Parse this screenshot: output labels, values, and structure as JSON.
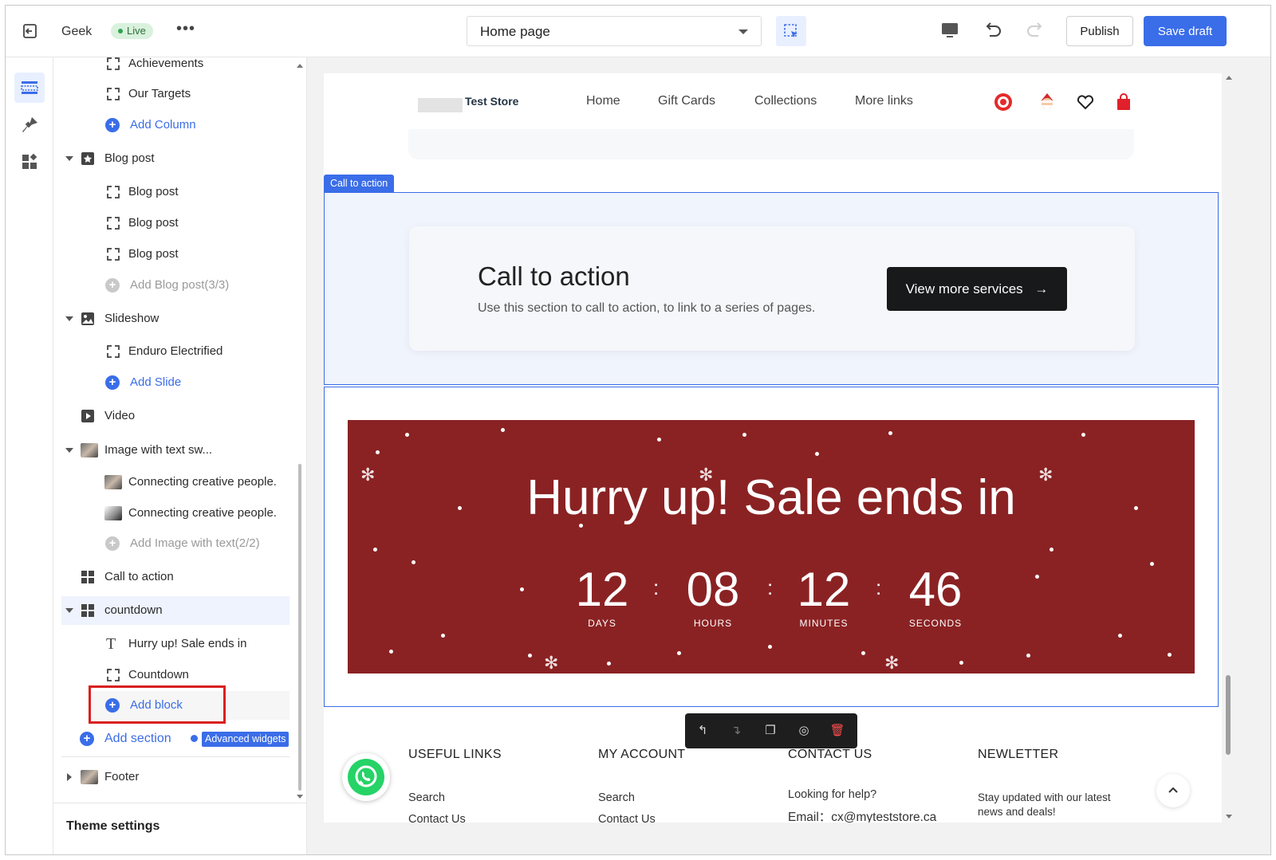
{
  "topbar": {
    "store_name": "Geek",
    "status_badge": "Live",
    "more_label": "•••",
    "page_select": "Home page",
    "publish_label": "Publish",
    "save_draft_label": "Save draft"
  },
  "sidebar": {
    "items": [
      {
        "label": "Achievements",
        "kind": "block"
      },
      {
        "label": "Our Targets",
        "kind": "block"
      },
      {
        "label": "Add Column",
        "kind": "add"
      },
      {
        "label": "Blog post",
        "kind": "section"
      },
      {
        "label": "Blog post",
        "kind": "block"
      },
      {
        "label": "Blog post",
        "kind": "block"
      },
      {
        "label": "Blog post",
        "kind": "block"
      },
      {
        "label": "Add Blog post(3/3)",
        "kind": "add-disabled"
      },
      {
        "label": "Slideshow",
        "kind": "section"
      },
      {
        "label": "Enduro Electrified",
        "kind": "block"
      },
      {
        "label": "Add Slide",
        "kind": "add"
      },
      {
        "label": "Video",
        "kind": "section"
      },
      {
        "label": "Image with text sw...",
        "kind": "section"
      },
      {
        "label": "Connecting creative people.",
        "kind": "block"
      },
      {
        "label": "Connecting creative people.",
        "kind": "block"
      },
      {
        "label": "Add Image with text(2/2)",
        "kind": "add-disabled"
      },
      {
        "label": "Call to action",
        "kind": "section"
      },
      {
        "label": "countdown",
        "kind": "section"
      },
      {
        "label": "Hurry up! Sale ends in",
        "kind": "block"
      },
      {
        "label": "Countdown",
        "kind": "block"
      },
      {
        "label": "Add block",
        "kind": "add"
      }
    ],
    "add_section_label": "Add section",
    "advanced_widgets_label": "Advanced widgets",
    "footer_label": "Footer",
    "theme_settings_label": "Theme settings"
  },
  "preview": {
    "store_name": "Test Store",
    "nav": [
      "Home",
      "Gift Cards",
      "Collections",
      "More links"
    ],
    "section_tag": "Call to action",
    "cta": {
      "title": "Call to action",
      "description": "Use this section to call to action, to link to a series of pages.",
      "button_label": "View more services",
      "button_arrow": "→"
    },
    "countdown": {
      "title": "Hurry up! Sale ends in",
      "units": [
        {
          "value": "12",
          "label": "DAYS"
        },
        {
          "value": "08",
          "label": "HOURS"
        },
        {
          "value": "12",
          "label": "MINUTES"
        },
        {
          "value": "46",
          "label": "SECONDS"
        }
      ],
      "separator": ":",
      "banner_color": "#8a2223"
    },
    "footer": {
      "columns": [
        {
          "heading": "USEFUL LINKS",
          "first_link": "Search",
          "second_link": "Contact Us"
        },
        {
          "heading": "MY ACCOUNT",
          "first_link": "Search",
          "second_link": "Contact Us"
        },
        {
          "heading": "CONTACT US",
          "first_link": "Looking for help?",
          "second_link": "Email：cx@myteststore.ca"
        },
        {
          "heading": "NEWLETTER",
          "first_link": "Stay updated with our latest",
          "second_link": "news and deals!"
        }
      ]
    }
  },
  "colors": {
    "accent": "#3a6de8",
    "highlight": "#d9201f",
    "dark_button": "#18191b"
  }
}
